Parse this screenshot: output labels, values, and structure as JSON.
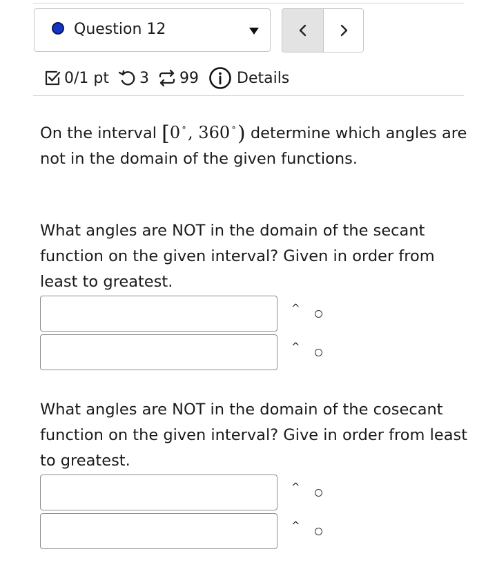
{
  "header": {
    "question_label": "Question 12",
    "prev_symbol": "‹",
    "next_symbol": "›"
  },
  "meta": {
    "score": "0/1 pt",
    "attempts": "3",
    "submissions": "99",
    "details_label": "Details"
  },
  "problem": {
    "intro_before": "On the interval",
    "interval": {
      "open": "[",
      "a": "0",
      "sep": ",",
      "b": "360",
      "deg": "∘",
      "close": ")"
    },
    "intro_after_line1": "determine which",
    "intro_rest": "angles are not in the domain of the given functions.",
    "secant_prompt": "What angles are NOT in the domain of the secant function on the given interval? Given in order from least to greatest.",
    "cosecant_prompt": "What angles are NOT in the domain of the cosecant function on the given interval? Give in order from least to greatest."
  },
  "answers": {
    "secant": [
      {
        "value": "",
        "unit_hint": "^",
        "degree_symbol": "°"
      },
      {
        "value": "",
        "unit_hint": "^",
        "degree_symbol": "°"
      }
    ],
    "cosecant": [
      {
        "value": "",
        "unit_hint": "^",
        "degree_symbol": "°"
      },
      {
        "value": "",
        "unit_hint": "^",
        "degree_symbol": "°"
      }
    ]
  },
  "colors": {
    "accent_dot": "#1434c8",
    "nav_prev_bg": "#e3e3e3",
    "border": "#c6c6c6"
  },
  "icons": [
    "status-dot-icon",
    "dropdown-caret-icon",
    "chevron-left-icon",
    "chevron-right-icon",
    "checkbox-score-icon",
    "retry-icon",
    "swap-icon",
    "info-icon"
  ]
}
